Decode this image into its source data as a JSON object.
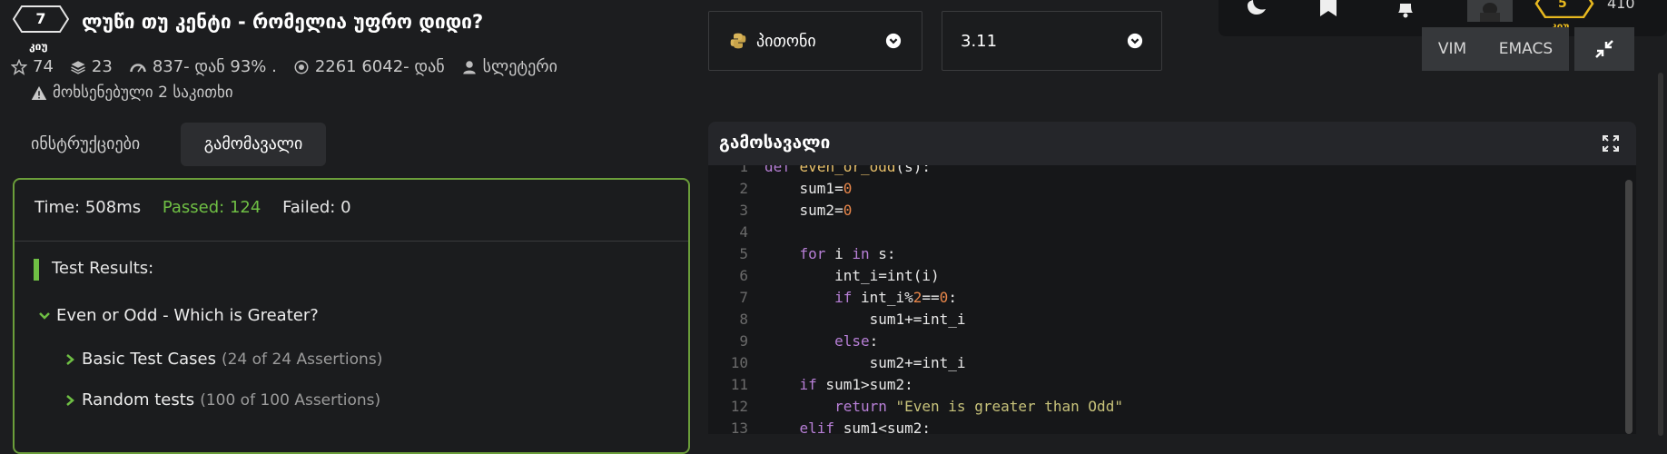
{
  "kata": {
    "rank": "7",
    "rank_label": "კიუ",
    "title": "ლუწი თუ კენტი - რომელია უფრო დიდი?",
    "stars": "74",
    "collections": "23",
    "satisfaction": "837- დან 93% .",
    "completions": "2261 6042- დან",
    "author": "სლეტერი",
    "issues": "მოხსენებული 2 საკითხი"
  },
  "tabs": {
    "instructions": "ინსტრუქციები",
    "output": "გამომავალი"
  },
  "results": {
    "time": "Time: 508ms",
    "passed": "Passed: 124",
    "failed": "Failed: 0",
    "heading": "Test Results:",
    "group": "Even or Odd - Which is Greater?",
    "cases": [
      {
        "name": "Basic Test Cases",
        "detail": "(24 of 24 Assertions)"
      },
      {
        "name": "Random tests",
        "detail": "(100 of 100 Assertions)"
      }
    ]
  },
  "editor": {
    "language": "პითონი",
    "version": "3.11",
    "keymap_vim": "VIM",
    "keymap_emacs": "EMACS",
    "output_title": "გამოსავალი",
    "user_rank": "5",
    "user_rank_label": "კიუ",
    "honor": "410"
  },
  "colors": {
    "accent_green": "#6fbf44",
    "rank_yellow": "#e7b81f",
    "keyword": "#b77fd6",
    "number": "#e8864a",
    "string": "#c7c27a"
  }
}
